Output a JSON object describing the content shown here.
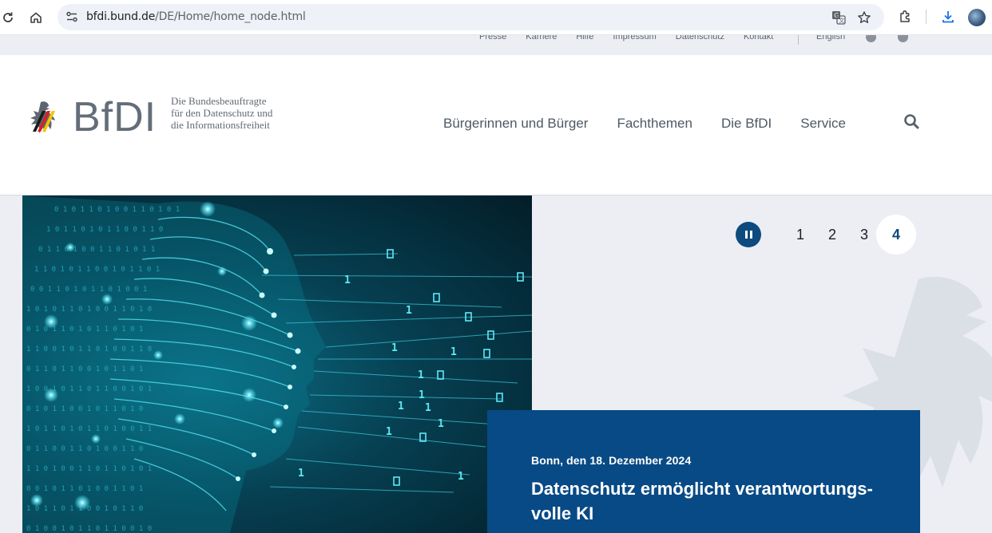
{
  "browser": {
    "url_domain": "bfdi.bund.de",
    "url_path": "/DE/Home/home_node.html",
    "icons": [
      "reload-icon",
      "home-icon",
      "site-info-icon",
      "translate-icon",
      "star-icon",
      "extensions-icon",
      "download-icon",
      "avatar"
    ]
  },
  "utility_nav": {
    "links": [
      "Presse",
      "Karriere",
      "Hilfe",
      "Impressum",
      "Datenschutz",
      "Kontakt"
    ],
    "language": "English"
  },
  "header": {
    "logo_text": "BfDI",
    "claim_line1": "Die Bundesbeauftragte",
    "claim_line2": "für den Datenschutz und",
    "claim_line3": "die Informationsfreiheit",
    "nav": [
      "Bürgerinnen und Bürger",
      "Fachthemen",
      "Die BfDI",
      "Service"
    ]
  },
  "slider": {
    "pages": [
      "1",
      "2",
      "3",
      "4"
    ],
    "active_page": "4"
  },
  "teaser": {
    "date": "Bonn, den 18. Dezember 2024",
    "title_line1": "Datenschutz ermöglicht verantwortungs-",
    "title_line2": "volle KI"
  },
  "colors": {
    "brand_blue": "#084a85",
    "hero_bg": "#eceef4",
    "nav_text": "#4d5965"
  }
}
